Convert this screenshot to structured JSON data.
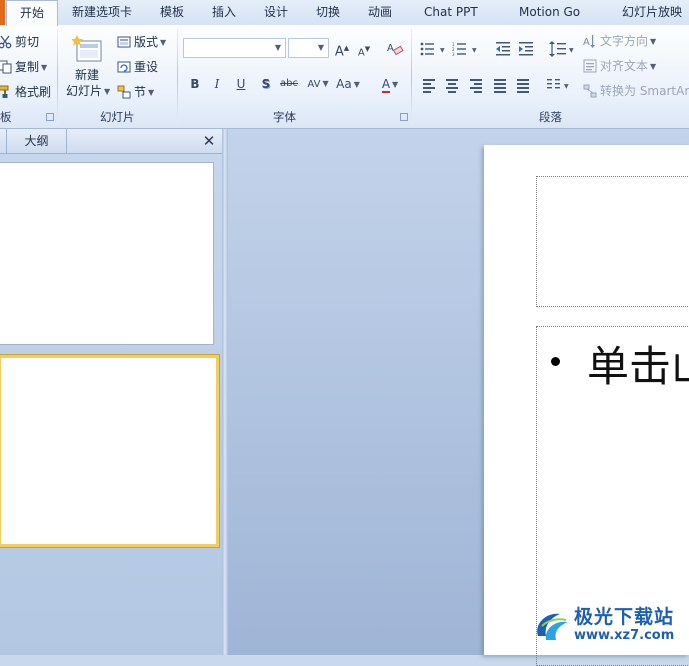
{
  "tabs": [
    "开始",
    "新建选项卡",
    "模板",
    "插入",
    "设计",
    "切换",
    "动画",
    "Chat PPT",
    "Motion Go",
    "幻灯片放映"
  ],
  "ribbon": {
    "clipboard": {
      "cut": "剪切",
      "copy": "复制",
      "format_painter": "格式刷",
      "group_label_partial": "板"
    },
    "slides": {
      "new_slide_line1": "新建",
      "new_slide_line2": "幻灯片",
      "layout": "版式",
      "reset": "重设",
      "section": "节",
      "group_label": "幻灯片"
    },
    "font": {
      "font_name_value": "",
      "font_size_value": "",
      "grow": "A",
      "shrink": "A",
      "bold": "B",
      "italic": "I",
      "underline": "U",
      "shadow": "S",
      "strike": "abc",
      "spacing": "AV",
      "case": "Aa",
      "color": "A",
      "group_label": "字体"
    },
    "paragraph": {
      "text_direction": "文字方向",
      "align_text": "对齐文本",
      "convert_smartart": "转换为 SmartAr",
      "group_label": "段落"
    }
  },
  "left_pane": {
    "outline_tab": "大纲",
    "close_glyph": "✕"
  },
  "slide": {
    "body_text": "单击山"
  },
  "watermark": {
    "name": "极光下载站",
    "url": "www.xz7.com"
  },
  "colors": {
    "accent_selected_thumb": "#f3cd5e",
    "file_tab": "#e06a1a",
    "watermark": "#1d5fb0"
  }
}
